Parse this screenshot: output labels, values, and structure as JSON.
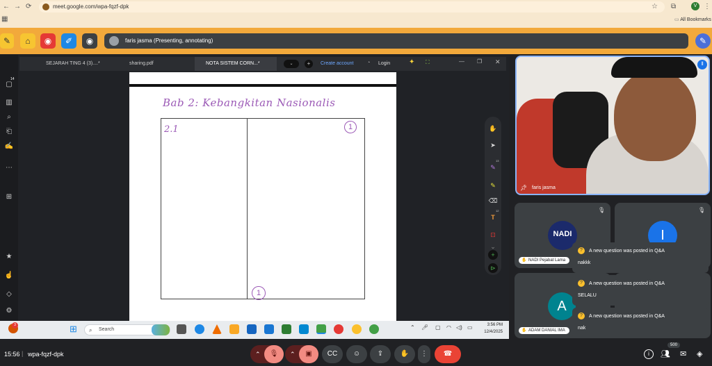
{
  "browser": {
    "url": "meet.google.com/wpa-fqzf-dpk",
    "bookmarks_label": "All Bookmarks",
    "profile_initial": "V"
  },
  "meet": {
    "presenting_text": "faris jasma (Presenting, annotating)",
    "clock": "15:56",
    "meeting_code": "wpa-fqzf-dpk",
    "people_count": "500"
  },
  "shared_app": {
    "tabs": [
      "SEJARAH TING 4 (3)....*",
      "sharing.pdf",
      "NOTA SISTEM CORN...*"
    ],
    "create_account": "Create account",
    "login": "Login",
    "left_badge": "14",
    "tool_badge_1": "13",
    "tool_badge_2": "12"
  },
  "notes": {
    "title": "Bab 2: Kebangkitan Nasionalis",
    "cell_label": "2.1",
    "circle_top": "1",
    "circle_bottom": "1"
  },
  "taskbar": {
    "search_placeholder": "Search",
    "time": "3:56 PM",
    "date": "12/4/2025",
    "notification_count": "3"
  },
  "participants": {
    "speaker_name": "faris jasma",
    "tile1_name": "NADI Pejabat Lama",
    "tile1_logo": "NADI",
    "tile2_initial": "I",
    "tile3_initial": "A",
    "tile3_name": "ADAM DANIAL IMA"
  },
  "notifications": [
    {
      "title": "A new question was posted in Q&A",
      "text": "nakkk"
    },
    {
      "title": "A new question was posted in Q&A",
      "text": "SELALU"
    },
    {
      "title": "A new question was posted in Q&A",
      "text": "nak"
    }
  ],
  "colors": {
    "meet_bar": "#f2a93b",
    "end_call": "#ea4335",
    "ink": "#9b59b6"
  }
}
